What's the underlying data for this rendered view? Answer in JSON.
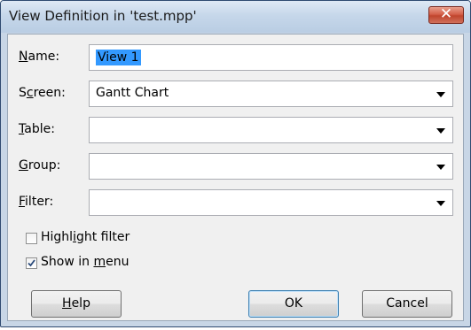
{
  "dialog": {
    "title": "View Definition in 'test.mpp'",
    "close_icon": "close-icon"
  },
  "fields": {
    "name": {
      "label_pre": "",
      "label_key": "N",
      "label_post": "ame:",
      "value": "View 1"
    },
    "screen": {
      "label_pre": "S",
      "label_key": "c",
      "label_post": "reen:",
      "value": "Gantt Chart"
    },
    "table": {
      "label_pre": "",
      "label_key": "T",
      "label_post": "able:",
      "value": ""
    },
    "group": {
      "label_pre": "",
      "label_key": "G",
      "label_post": "roup:",
      "value": ""
    },
    "filter": {
      "label_pre": "",
      "label_key": "F",
      "label_post": "ilter:",
      "value": ""
    }
  },
  "checkboxes": {
    "highlight": {
      "label_pre": "Highl",
      "label_key": "i",
      "label_post": "ght filter",
      "checked": false
    },
    "show_menu": {
      "label_pre": "Show in ",
      "label_key": "m",
      "label_post": "enu",
      "checked": true
    }
  },
  "buttons": {
    "help": {
      "label_pre": "",
      "label_key": "H",
      "label_post": "elp"
    },
    "ok": "OK",
    "cancel": "Cancel"
  }
}
